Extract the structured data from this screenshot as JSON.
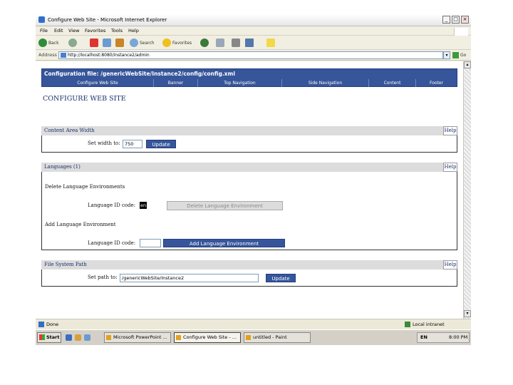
{
  "window": {
    "title": "Configure Web Site - Microsoft Internet Explorer",
    "minimize": "_",
    "maximize": "□",
    "close": "×"
  },
  "menu": [
    "File",
    "Edit",
    "View",
    "Favorites",
    "Tools",
    "Help"
  ],
  "toolbar": {
    "back_label": "Back",
    "search_label": "Search",
    "favorites_label": "Favorites"
  },
  "address": {
    "label": "Address",
    "url": "http://localhost:8080/instance2/admin",
    "go_label": "Go"
  },
  "page": {
    "config_path": "Configuration file: /genericWebSite/Instance2/config/config.xml",
    "nav": [
      "Configure Web Site",
      "Banner",
      "Top Navigation",
      "Side Navigation",
      "Content",
      "Footer"
    ],
    "heading": "CONFIGURE WEB SITE",
    "help_label": "Help",
    "content_width": {
      "title": "Content Area Width",
      "label": "Set width to:",
      "value": "750",
      "button": "Update"
    },
    "languages": {
      "title": "Languages (1)",
      "delete_heading": "Delete Language Environments",
      "delete_label": "Language ID code:",
      "delete_value": "en",
      "delete_button": "Delete Language Environment",
      "add_heading": "Add Language Environment",
      "add_label": "Language ID code:",
      "add_value": "",
      "add_button": "Add Language Environment"
    },
    "file_system": {
      "title": "File System Path",
      "label": "Set path to:",
      "value": "/genericWebSite/Instance2",
      "button": "Update"
    }
  },
  "status": {
    "text": "Done",
    "zone": "Local intranet"
  },
  "taskbar": {
    "start": "Start",
    "tasks": [
      "Microsoft PowerPoint ...",
      "Configure Web Site - ...",
      "untitled - Paint"
    ],
    "clock": "8:00 PM",
    "lang": "EN"
  },
  "colors": {
    "header_blue": "#36559a",
    "section_grey": "#dcdcdc",
    "title_navy": "#1c2f6a"
  }
}
